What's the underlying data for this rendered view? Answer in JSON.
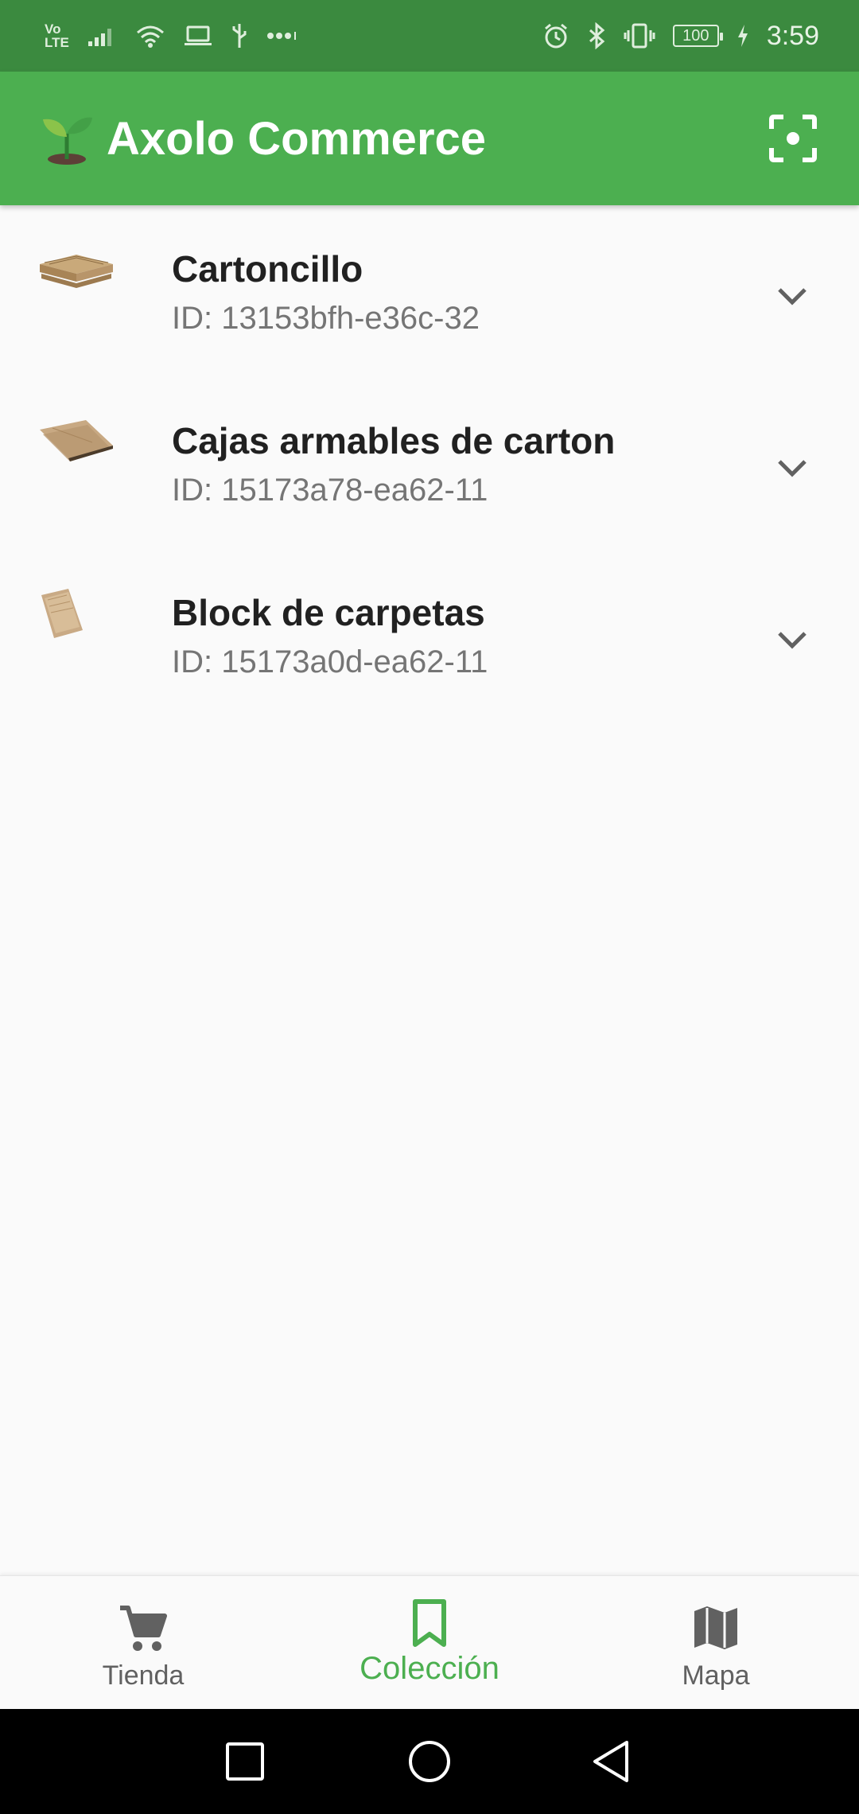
{
  "status_bar": {
    "network": [
      "Vo",
      "LTE"
    ],
    "battery": "100",
    "time": "3:59"
  },
  "app_bar": {
    "title": "Axolo Commerce",
    "logo_icon": "seedling-icon",
    "scan_icon": "scan-focus-icon"
  },
  "items": [
    {
      "title": "Cartoncillo",
      "subtitle": "ID: 13153bfh-e36c-32",
      "thumb": "cardboard-stack-thumbnail"
    },
    {
      "title": "Cajas armables de carton",
      "subtitle": "ID: 15173a78-ea62-11",
      "thumb": "flat-boxes-thumbnail"
    },
    {
      "title": "Block de carpetas",
      "subtitle": "ID: 15173a0d-ea62-11",
      "thumb": "folder-block-thumbnail"
    }
  ],
  "bottom_nav": {
    "items": [
      {
        "label": "Tienda",
        "icon": "cart-icon",
        "active": false
      },
      {
        "label": "Colección",
        "icon": "bookmark-icon",
        "active": true
      },
      {
        "label": "Mapa",
        "icon": "map-icon",
        "active": false
      }
    ]
  },
  "colors": {
    "primary": "#4caf50",
    "status_bar": "#3b8a3f",
    "active_nav": "#4caf50",
    "text_primary": "#212121",
    "text_secondary": "#757575"
  }
}
